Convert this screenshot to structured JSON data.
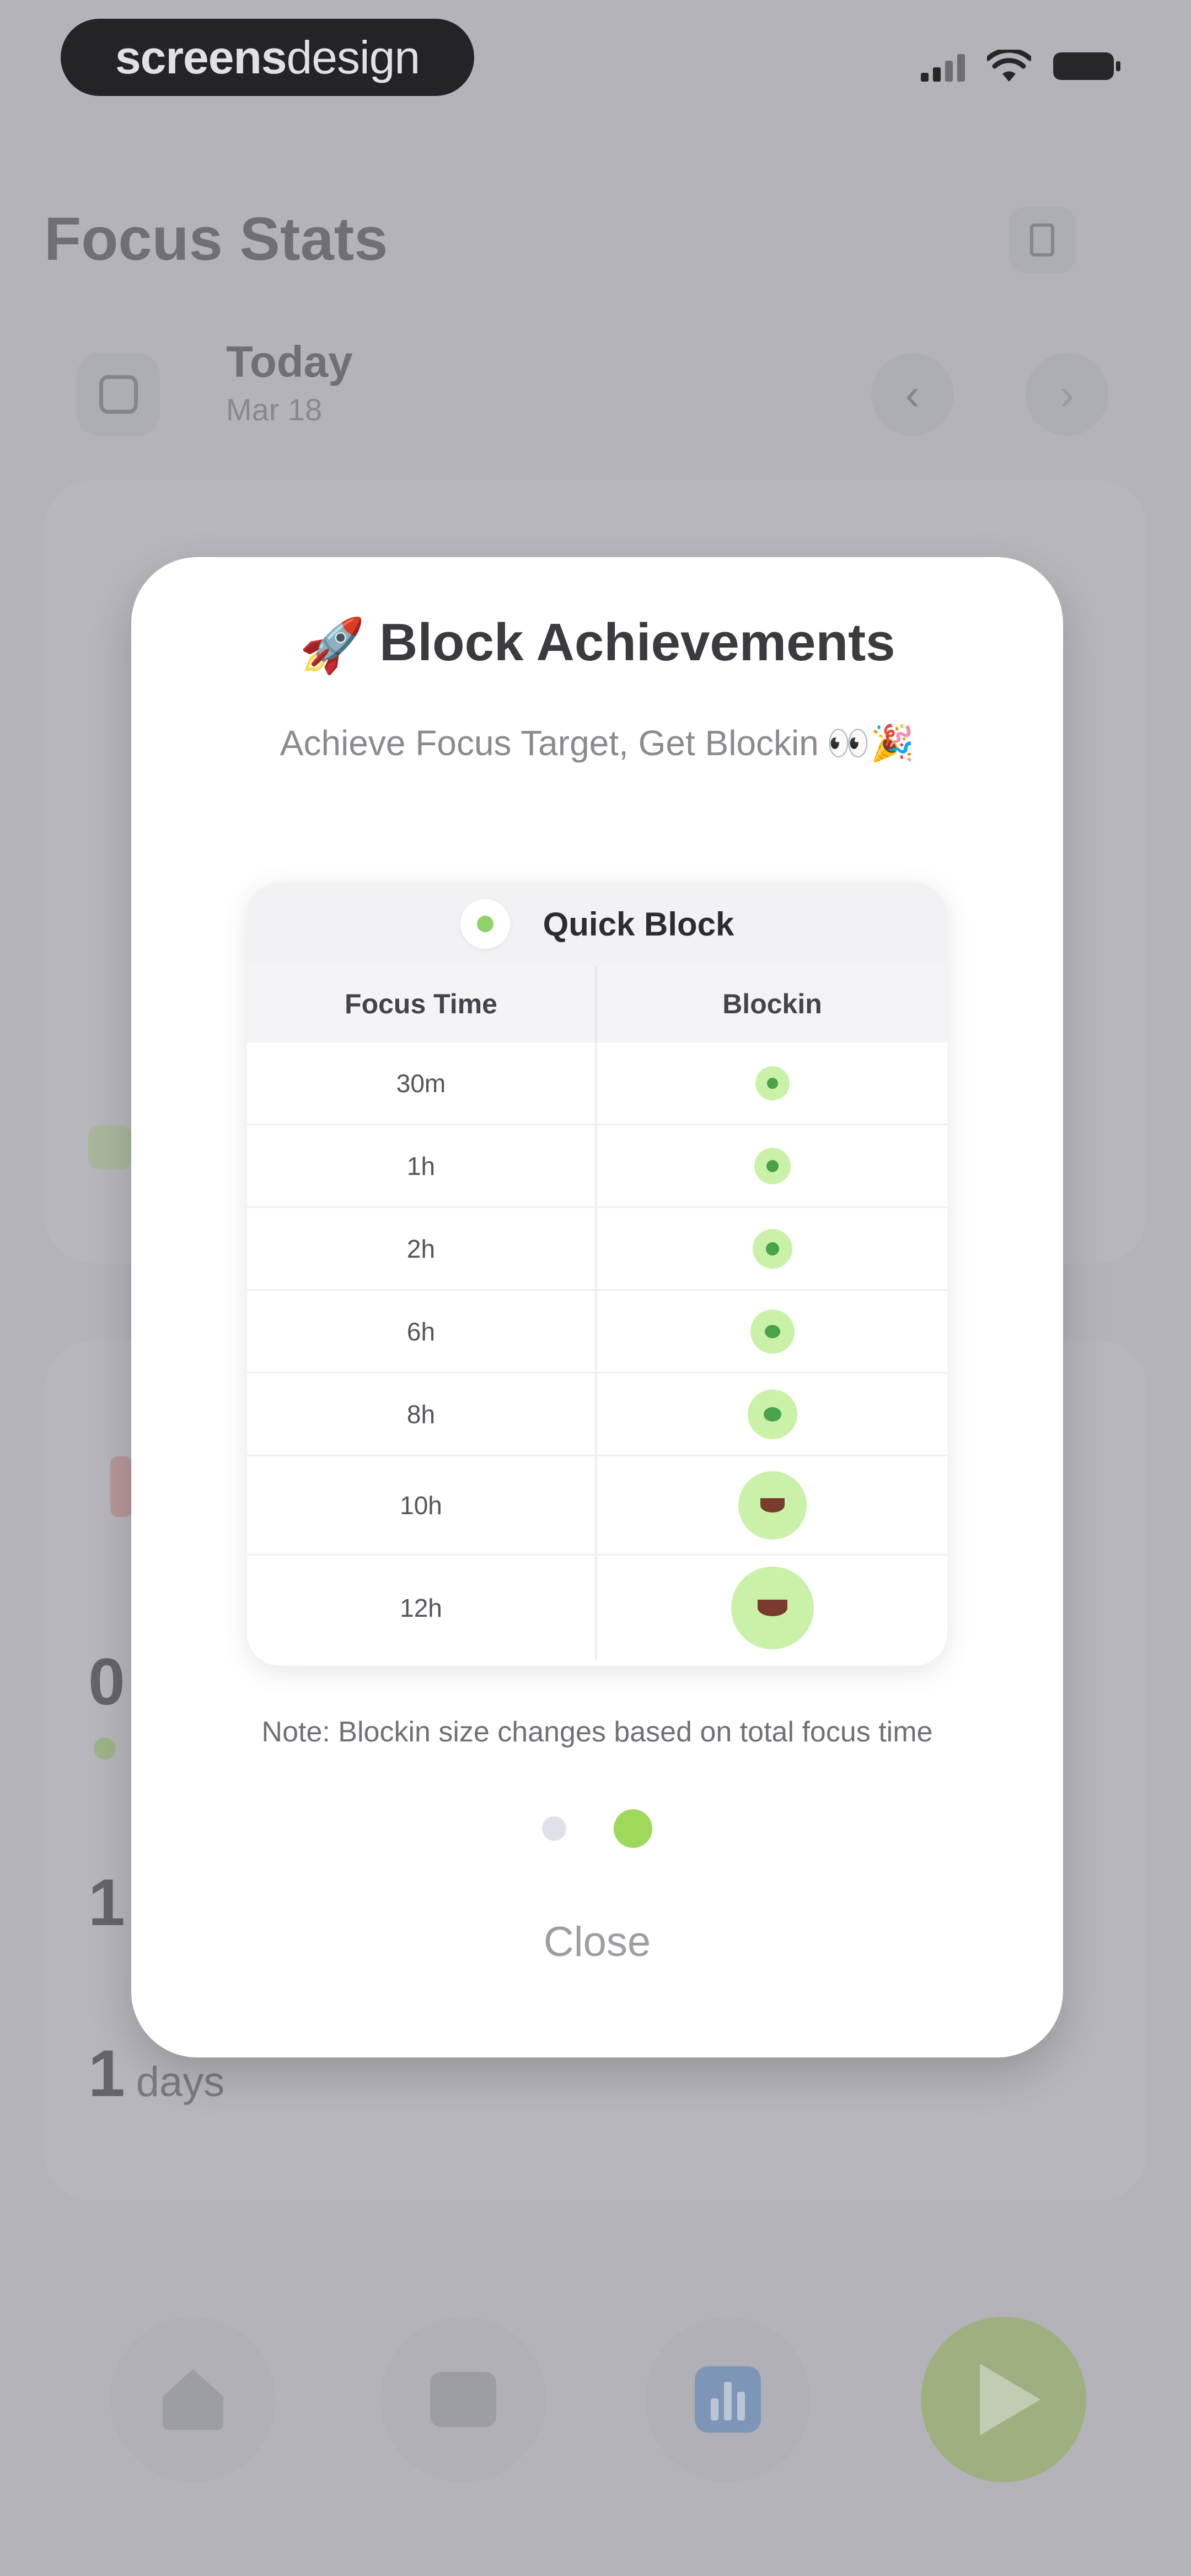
{
  "status_bar": {
    "brand_bold": "screens",
    "brand_light": "design"
  },
  "header": {
    "title": "Focus Stats"
  },
  "date": {
    "label": "Today",
    "sub": "Mar 18"
  },
  "background_stats": {
    "stat1_value": "0",
    "stat2_value": "1",
    "stat3_value": "1",
    "stat3_unit": "days"
  },
  "modal": {
    "title": "Block Achievements",
    "title_icon": "🚀",
    "subtitle": "Achieve Focus Target, Get Blockin",
    "subtitle_emoji": "👀🎉",
    "table": {
      "title": "Quick Block",
      "columns": [
        "Focus Time",
        "Blockin"
      ],
      "rows": [
        {
          "time": "30m",
          "icon": "blockin-tiny"
        },
        {
          "time": "1h",
          "icon": "blockin-tiny"
        },
        {
          "time": "2h",
          "icon": "blockin-small"
        },
        {
          "time": "6h",
          "icon": "blockin-small"
        },
        {
          "time": "8h",
          "icon": "blockin-medium"
        },
        {
          "time": "10h",
          "icon": "blockin-large"
        },
        {
          "time": "12h",
          "icon": "blockin-xlarge"
        }
      ]
    },
    "note": "Note: Blockin size changes based on total focus time",
    "pagination": {
      "total": 2,
      "active": 2
    },
    "close_label": "Close"
  },
  "tab_bar": {
    "items": [
      "home-icon",
      "focus-icon",
      "stats-icon",
      "play-icon"
    ]
  },
  "colors": {
    "accent_green": "#9fd85a",
    "blockin_green": "#c9f2a8",
    "stats_blue": "#7f9ec6"
  }
}
